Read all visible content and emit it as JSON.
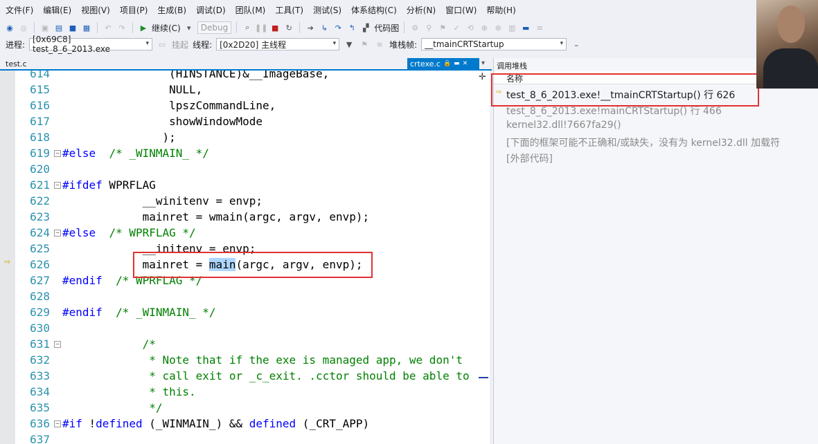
{
  "menu": [
    "文件(F)",
    "编辑(E)",
    "视图(V)",
    "项目(P)",
    "生成(B)",
    "调试(D)",
    "团队(M)",
    "工具(T)",
    "测试(S)",
    "体系结构(C)",
    "分析(N)",
    "窗口(W)",
    "帮助(H)"
  ],
  "toolbar1": {
    "continue_label": "继续(C)",
    "config_value": "Debug",
    "codemap_label": "代码图"
  },
  "toolbar2": {
    "process_label": "进程:",
    "process_value": "[0x69C8] test_8_6_2013.exe",
    "suspend_label": "挂起",
    "thread_label": "线程:",
    "thread_value": "[0x2D20] 主线程",
    "stackframe_label": "堆栈帧:",
    "stackframe_value": "__tmainCRTStartup"
  },
  "tabs": {
    "left_file": "test.c",
    "active_file": "crtexe.c"
  },
  "editor": {
    "lines": [
      {
        "n": "614",
        "parts": [
          {
            "t": "                (HINSTANCE)&__ImageBase,",
            "c": ""
          }
        ]
      },
      {
        "n": "615",
        "parts": [
          {
            "t": "                NULL,",
            "c": ""
          }
        ]
      },
      {
        "n": "616",
        "parts": [
          {
            "t": "                lpszCommandLine,",
            "c": ""
          }
        ]
      },
      {
        "n": "617",
        "parts": [
          {
            "t": "                showWindowMode",
            "c": ""
          }
        ]
      },
      {
        "n": "618",
        "parts": [
          {
            "t": "               );",
            "c": ""
          }
        ]
      },
      {
        "n": "619",
        "parts": [
          {
            "t": "#else",
            "c": "kw"
          },
          {
            "t": "  /* _WINMAIN_ */",
            "c": "cm"
          }
        ]
      },
      {
        "n": "620",
        "parts": []
      },
      {
        "n": "621",
        "parts": [
          {
            "t": "#ifdef",
            "c": "kw"
          },
          {
            "t": " WPRFLAG",
            "c": ""
          }
        ]
      },
      {
        "n": "622",
        "parts": [
          {
            "t": "            __winitenv = envp;",
            "c": ""
          }
        ]
      },
      {
        "n": "623",
        "parts": [
          {
            "t": "            mainret = wmain(argc, argv, envp);",
            "c": ""
          }
        ]
      },
      {
        "n": "624",
        "parts": [
          {
            "t": "#else",
            "c": "kw"
          },
          {
            "t": "  /* WPRFLAG */",
            "c": "cm"
          }
        ]
      },
      {
        "n": "625",
        "parts": [
          {
            "t": "            __initenv = envp;",
            "c": ""
          }
        ]
      },
      {
        "n": "626",
        "parts": [
          {
            "t": "            mainret = ",
            "c": ""
          },
          {
            "t": "main",
            "c": "sel"
          },
          {
            "t": "(argc, argv, envp);",
            "c": ""
          }
        ]
      },
      {
        "n": "627",
        "parts": [
          {
            "t": "#endif",
            "c": "kw"
          },
          {
            "t": "  /* WPRFLAG */",
            "c": "cm"
          }
        ]
      },
      {
        "n": "628",
        "parts": []
      },
      {
        "n": "629",
        "parts": [
          {
            "t": "#endif",
            "c": "kw"
          },
          {
            "t": "  /* _WINMAIN_ */",
            "c": "cm"
          }
        ]
      },
      {
        "n": "630",
        "parts": []
      },
      {
        "n": "631",
        "parts": [
          {
            "t": "            /*",
            "c": "cm"
          }
        ]
      },
      {
        "n": "632",
        "parts": [
          {
            "t": "             * Note that if the exe is managed app, we don't",
            "c": "cm"
          }
        ]
      },
      {
        "n": "633",
        "parts": [
          {
            "t": "             * call exit or _c_exit. .cctor should be able to",
            "c": "cm"
          }
        ]
      },
      {
        "n": "634",
        "parts": [
          {
            "t": "             * this.",
            "c": "cm"
          }
        ]
      },
      {
        "n": "635",
        "parts": [
          {
            "t": "             */",
            "c": "cm"
          }
        ]
      },
      {
        "n": "636",
        "parts": [
          {
            "t": "#if",
            "c": "kw"
          },
          {
            "t": " !",
            "c": ""
          },
          {
            "t": "defined",
            "c": "kw"
          },
          {
            "t": " (_WINMAIN_) && ",
            "c": ""
          },
          {
            "t": "defined",
            "c": "kw"
          },
          {
            "t": " (_CRT_APP)",
            "c": ""
          }
        ]
      },
      {
        "n": "637",
        "parts": []
      }
    ]
  },
  "callstack": {
    "title": "调用堆栈",
    "column_name": "名称",
    "rows": [
      "test_8_6_2013.exe!__tmainCRTStartup() 行 626",
      "test_8_6_2013.exe!mainCRTStartup() 行 466",
      "kernel32.dll!7667fa29()",
      "[下面的框架可能不正确和/或缺失，没有为 kernel32.dll 加载符",
      "[外部代码]"
    ]
  }
}
